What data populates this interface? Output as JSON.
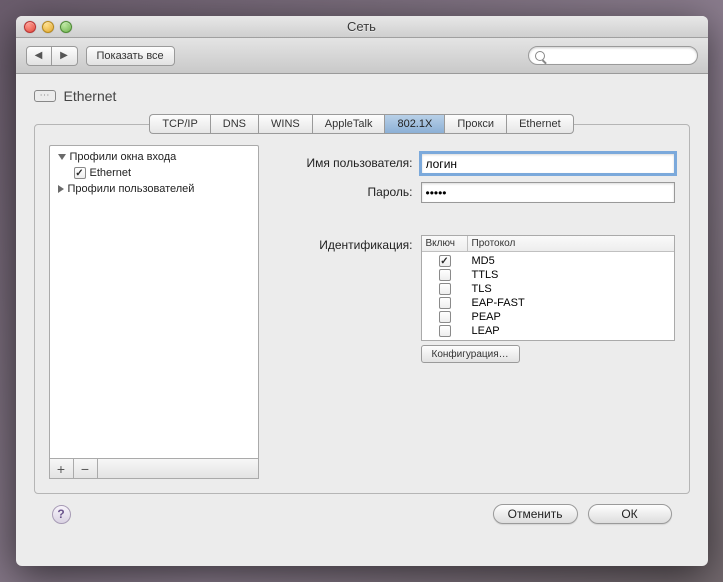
{
  "window": {
    "title": "Сеть"
  },
  "toolbar": {
    "show_all": "Показать все",
    "search_placeholder": ""
  },
  "breadcrumb": {
    "interface": "Ethernet"
  },
  "tabs": [
    {
      "label": "TCP/IP",
      "active": false
    },
    {
      "label": "DNS",
      "active": false
    },
    {
      "label": "WINS",
      "active": false
    },
    {
      "label": "AppleTalk",
      "active": false
    },
    {
      "label": "802.1X",
      "active": true
    },
    {
      "label": "Прокси",
      "active": false
    },
    {
      "label": "Ethernet",
      "active": false
    }
  ],
  "profiles": {
    "login_window": {
      "label": "Профили окна входа",
      "expanded": true
    },
    "ethernet": {
      "label": "Ethernet",
      "checked": true
    },
    "user": {
      "label": "Профили пользователей",
      "expanded": false
    }
  },
  "form": {
    "username_label": "Имя пользователя:",
    "username_value": "логин",
    "password_label": "Пароль:",
    "password_value": "•••••",
    "ident_label": "Идентификация:",
    "table_headers": {
      "enabled": "Включ",
      "protocol": "Протокол"
    },
    "protocols": [
      {
        "name": "MD5",
        "checked": true
      },
      {
        "name": "TTLS",
        "checked": false
      },
      {
        "name": "TLS",
        "checked": false
      },
      {
        "name": "EAP-FAST",
        "checked": false
      },
      {
        "name": "PEAP",
        "checked": false
      },
      {
        "name": "LEAP",
        "checked": false
      }
    ],
    "config_button": "Конфигурация…"
  },
  "footer": {
    "cancel": "Отменить",
    "ok": "ОК"
  }
}
